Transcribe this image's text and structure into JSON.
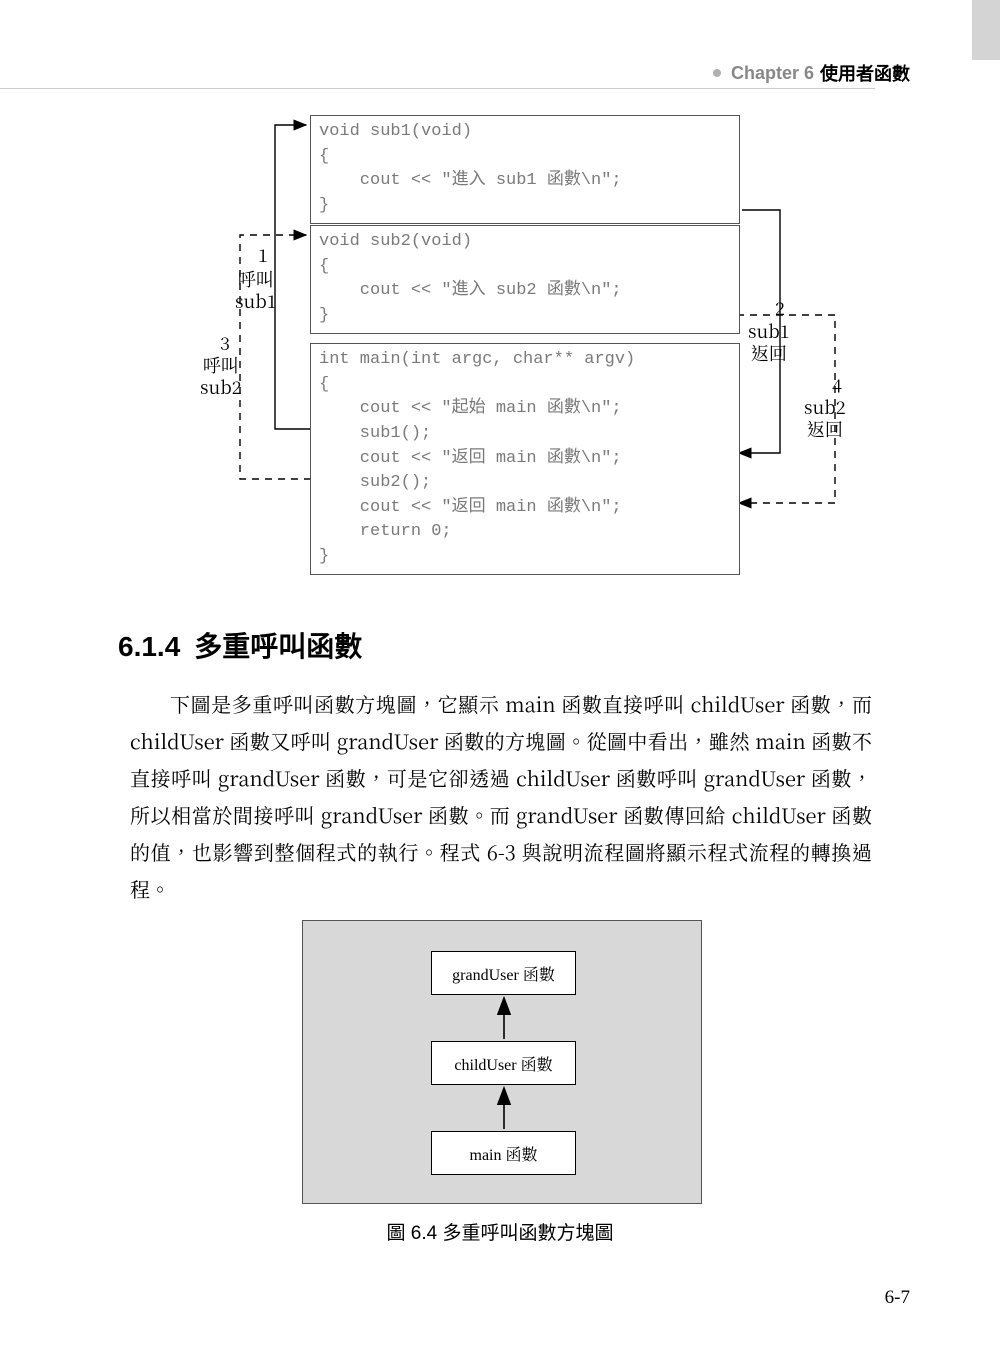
{
  "header": {
    "chapter_label": "Chapter 6",
    "chapter_title": "使用者函數"
  },
  "diagram1": {
    "sub1_code": "void sub1(void)\n{\n    cout << \"進入 sub1 函數\\n\";\n}",
    "sub2_code": "void sub2(void)\n{\n    cout << \"進入 sub2 函數\\n\";\n}",
    "main_code": "int main(int argc, char** argv)\n{\n    cout << \"起始 main 函數\\n\";\n    sub1();\n    cout << \"返回 main 函數\\n\";\n    sub2();\n    cout << \"返回 main 函數\\n\";\n    return 0;\n}",
    "labels": {
      "call_sub1_num": "1",
      "call_sub1": "呼叫\nsub1",
      "sub1_return_num": "2",
      "sub1_return": "sub1\n返回",
      "call_sub2_num": "3",
      "call_sub2": "呼叫\nsub2",
      "sub2_return_num": "4",
      "sub2_return": "sub2\n返回"
    }
  },
  "section": {
    "number": "6.1.4",
    "title": "多重呼叫函數"
  },
  "paragraph": "下圖是多重呼叫函數方塊圖，它顯示 main 函數直接呼叫 childUser 函數，而 childUser 函數又呼叫 grandUser 函數的方塊圖。從圖中看出，雖然 main 函數不直接呼叫 grandUser 函數，可是它卻透過 childUser 函數呼叫 grandUser 函數，所以相當於間接呼叫 grandUser 函數。而 grandUser 函數傳回給 childUser 函數的值，也影響到整個程式的執行。程式 6-3 與說明流程圖將顯示程式流程的轉換過程。",
  "block_diagram": {
    "grand": "grandUser 函數",
    "child": "childUser 函數",
    "main": "main 函數"
  },
  "figure_caption": "圖 6.4  多重呼叫函數方塊圖",
  "page_number": "6-7"
}
